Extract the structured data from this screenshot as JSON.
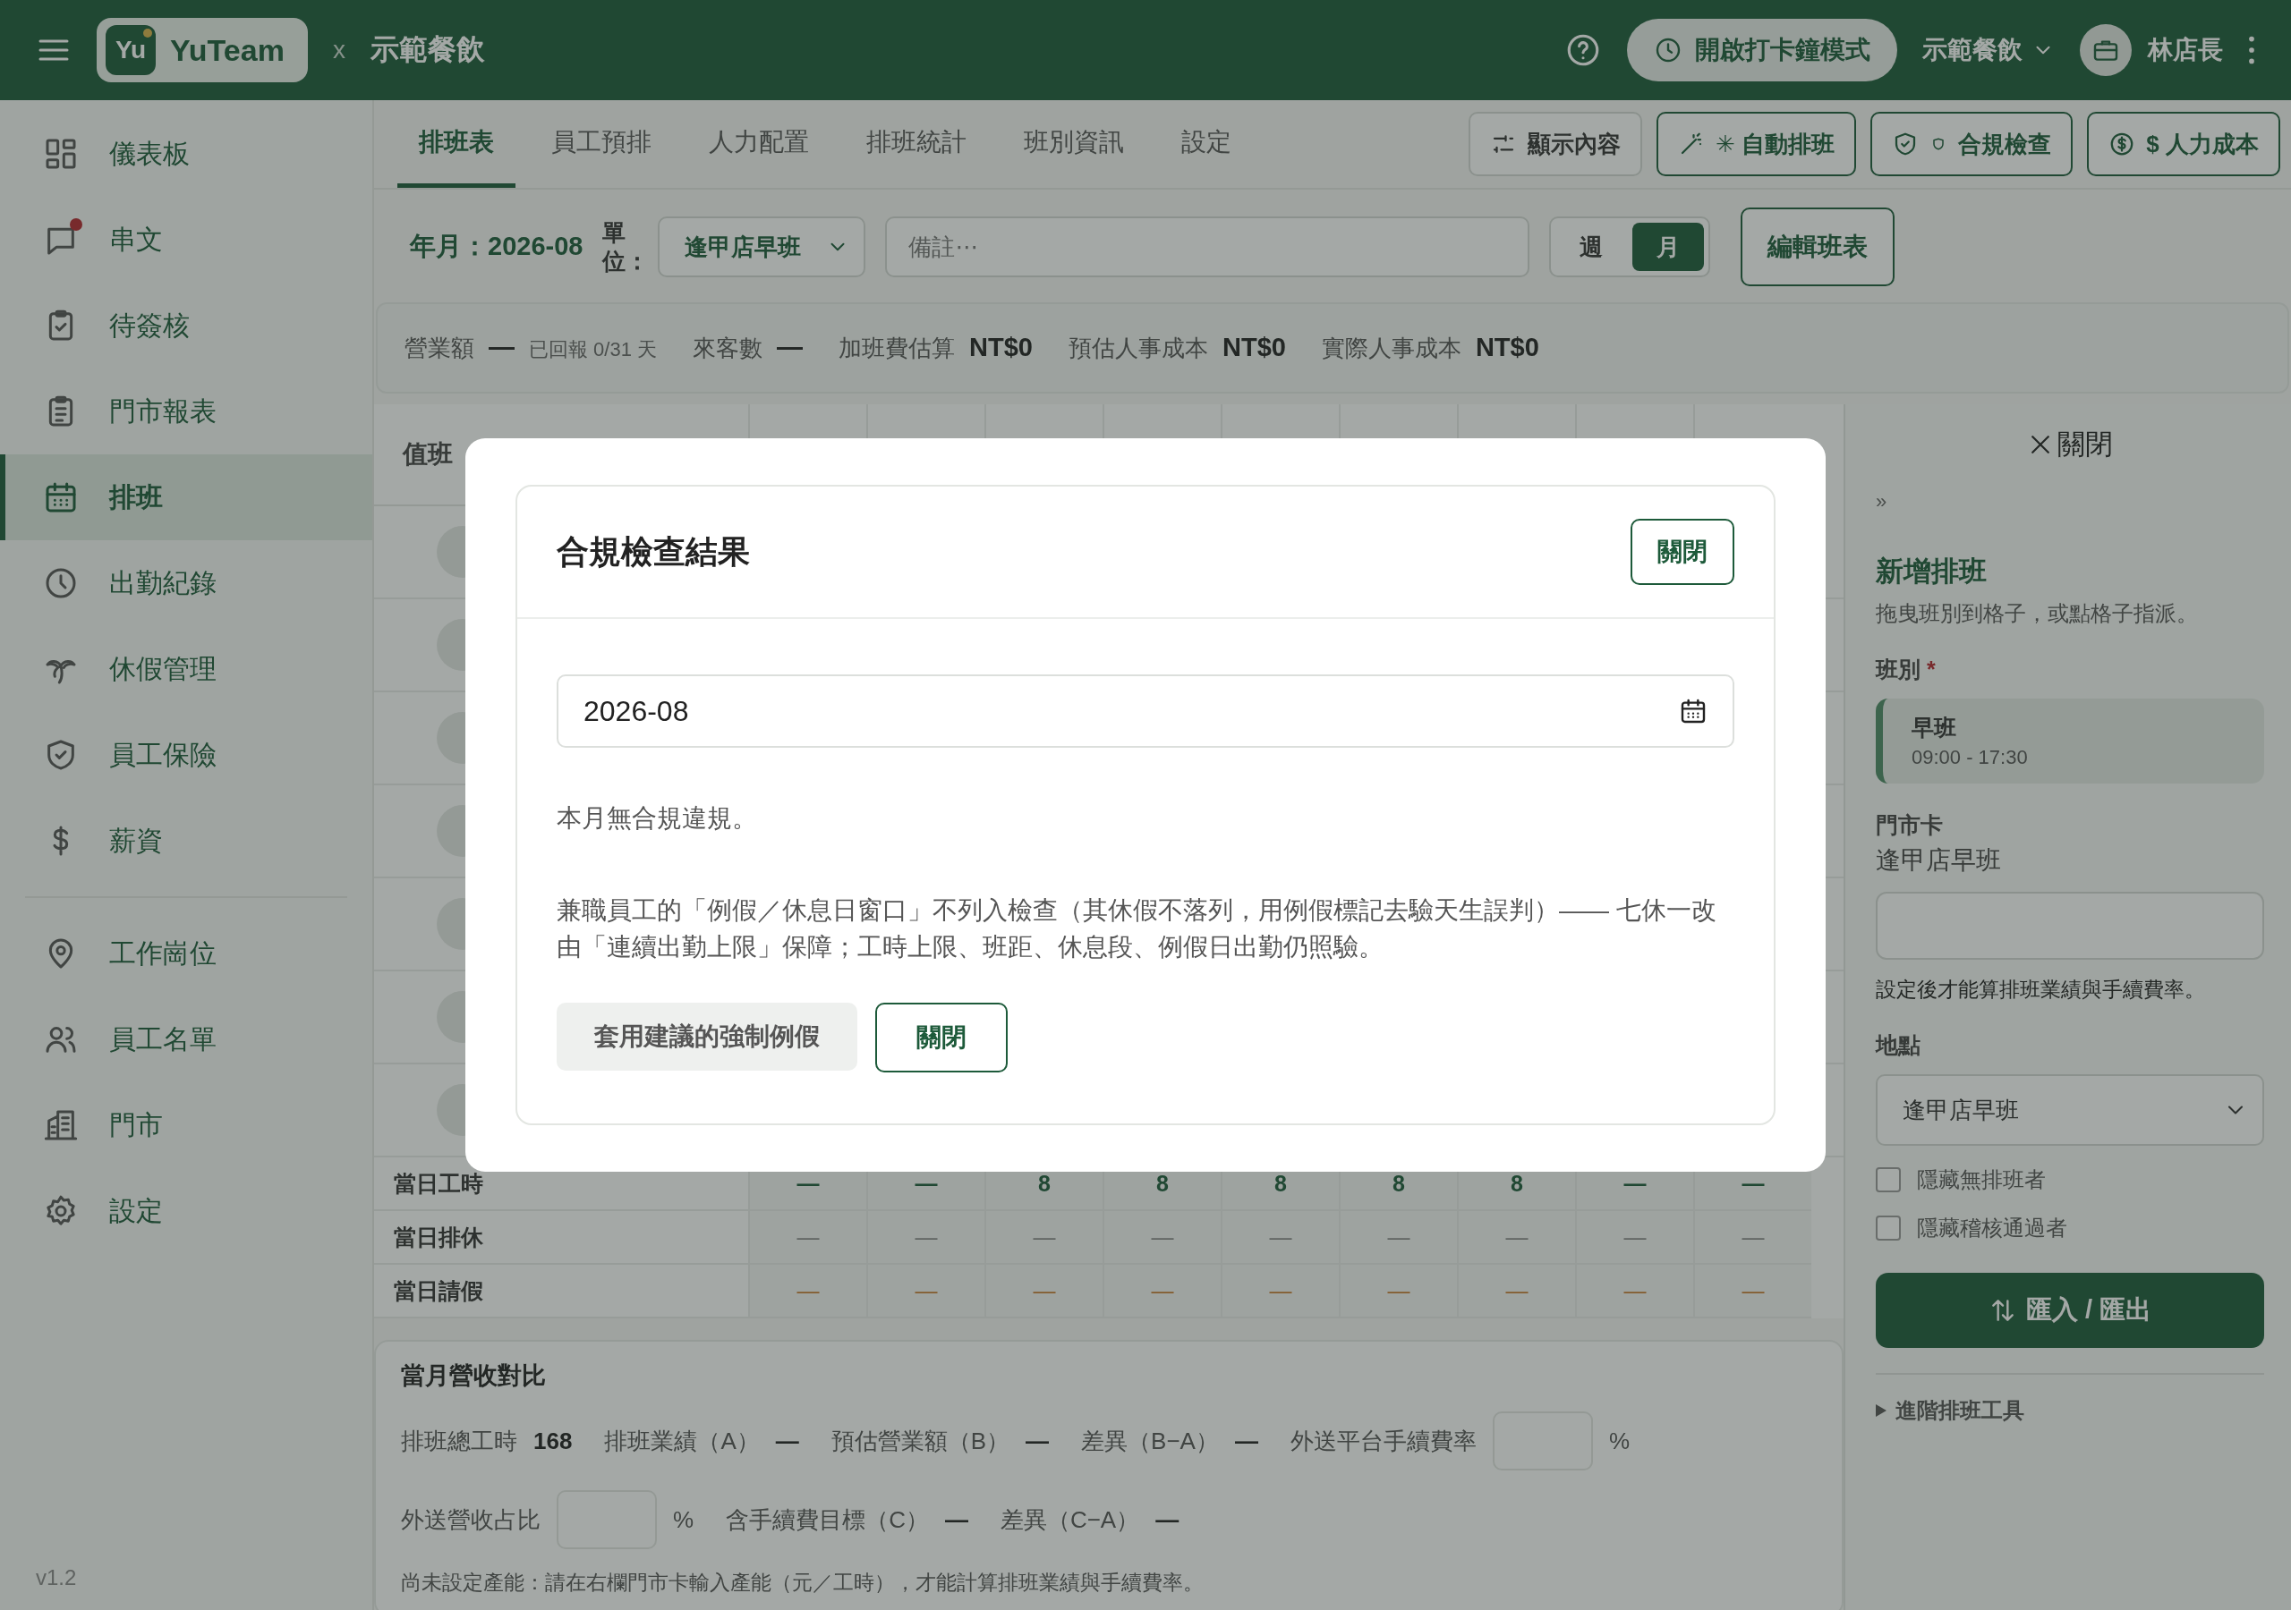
{
  "topbar": {
    "badge": "Yu",
    "brand": "YuTeam",
    "separator": "x",
    "org": "示範餐飲",
    "clock_button": "開啟打卡鐘模式",
    "org_switch": "示範餐飲",
    "user": "林店長"
  },
  "sidebar": {
    "sections": [
      {
        "items": [
          {
            "label": "儀表板",
            "selected": false,
            "notification": false
          },
          {
            "label": "串文",
            "selected": false,
            "notification": true
          },
          {
            "label": "待簽核",
            "selected": false,
            "notification": false
          },
          {
            "label": "門市報表",
            "selected": false,
            "notification": false
          },
          {
            "label": "排班",
            "selected": true,
            "notification": false
          },
          {
            "label": "出勤紀錄",
            "selected": false,
            "notification": false
          },
          {
            "label": "休假管理",
            "selected": false,
            "notification": false
          },
          {
            "label": "員工保險",
            "selected": false,
            "notification": false
          },
          {
            "label": "薪資",
            "selected": false,
            "notification": false
          }
        ]
      },
      {
        "items": [
          {
            "label": "工作崗位",
            "selected": false,
            "notification": false
          },
          {
            "label": "員工名單",
            "selected": false,
            "notification": false
          },
          {
            "label": "門市",
            "selected": false,
            "notification": false
          },
          {
            "label": "設定",
            "selected": false,
            "notification": false
          }
        ]
      }
    ],
    "version": "v1.2"
  },
  "tabs": [
    {
      "label": "排班表",
      "selected": true
    },
    {
      "label": "員工預排",
      "selected": false
    },
    {
      "label": "人力配置",
      "selected": false
    },
    {
      "label": "排班統計",
      "selected": false
    },
    {
      "label": "班別資訊",
      "selected": false
    },
    {
      "label": "設定",
      "selected": false
    }
  ],
  "toolbar": [
    "顯示內容",
    "✳ 自動排班",
    "合規檢查",
    "$ 人力成本"
  ],
  "filters": {
    "month": "年月：2026-08",
    "unit_label": "單位：",
    "unit": "逢甲店早班",
    "note_placeholder": "備註⋯",
    "view_toggle": [
      {
        "label": "週",
        "selected": false
      },
      {
        "label": "月",
        "selected": true
      }
    ],
    "edit_button": "編輯班表"
  },
  "stats": [
    {
      "label": "營業額",
      "value": "—",
      "note": "已回報 0/31 天"
    },
    {
      "label": "來客數",
      "value": "—"
    },
    {
      "label": "加班費估算",
      "value": "NT$0"
    },
    {
      "label": "預估人事成本",
      "value": "NT$0"
    },
    {
      "label": "實際人事成本",
      "value": "NT$0"
    }
  ],
  "schedule": {
    "header": "值班",
    "summary": [
      {
        "label": "當日工時",
        "kind": "hours",
        "values": [
          "—",
          "—",
          "8",
          "8",
          "8",
          "8",
          "8",
          "—",
          "—"
        ]
      },
      {
        "label": "當日排休",
        "kind": "rest",
        "values": [
          "—",
          "—",
          "—",
          "—",
          "—",
          "—",
          "—",
          "—",
          "—"
        ]
      },
      {
        "label": "當日請假",
        "kind": "leave",
        "values": [
          "—",
          "—",
          "—",
          "—",
          "—",
          "—",
          "—",
          "—",
          "—"
        ]
      }
    ]
  },
  "revenue": {
    "title": "當月營收對比",
    "row_1": [
      {
        "label": "排班總工時",
        "value": "168"
      },
      {
        "label": "排班業績（A）",
        "value": "—"
      },
      {
        "label": "預估營業額（B）",
        "value": "—"
      },
      {
        "label": "差異（B−A）",
        "value": "—"
      }
    ],
    "fee_rate": {
      "label": "外送平台手續費率",
      "unit": "%"
    },
    "delivery_share": {
      "label": "外送營收占比",
      "unit": "%"
    },
    "row_2": [
      {
        "label": "含手續費目標（C）",
        "value": "—"
      },
      {
        "label": "差異（C−A）",
        "value": "—"
      }
    ],
    "note": "尚未設定產能：請在右欄門市卡輸入產能（元／工時），才能計算排班業績與手續費率。"
  },
  "panel": {
    "close": "關閉",
    "collapse": "»",
    "title": "新增排班",
    "hint": "拖曳班別到格子，或點格子指派。",
    "shift_label": "班別",
    "required": "*",
    "shift": {
      "name": "早班",
      "time": "09:00 - 17:30"
    },
    "store_card_label": "門市卡",
    "store_card_name": "逢甲店早班",
    "store_hint": "設定後才能算排班業績與手續費率。",
    "location_label": "地點",
    "location": "逢甲店早班",
    "options": [
      {
        "label": "隱藏無排班者",
        "checked": false
      },
      {
        "label": "隱藏稽核通過者",
        "checked": false
      }
    ],
    "import_export": "匯入 / 匯出",
    "advanced": "進階排班工具"
  },
  "modal": {
    "title": "合規檢查結果",
    "close_button": "關閉",
    "month": "2026-08",
    "message": "本月無合規違規。",
    "note": "兼職員工的「例假／休息日窗口」不列入檢查（其休假不落列，用例假標記去驗天生誤判）—— 七休一改由「連續出勤上限」保障；工時上限、班距、休息段、例假日出勤仍照驗。",
    "apply_button": "套用建議的強制例假",
    "footer_close": "關閉"
  }
}
